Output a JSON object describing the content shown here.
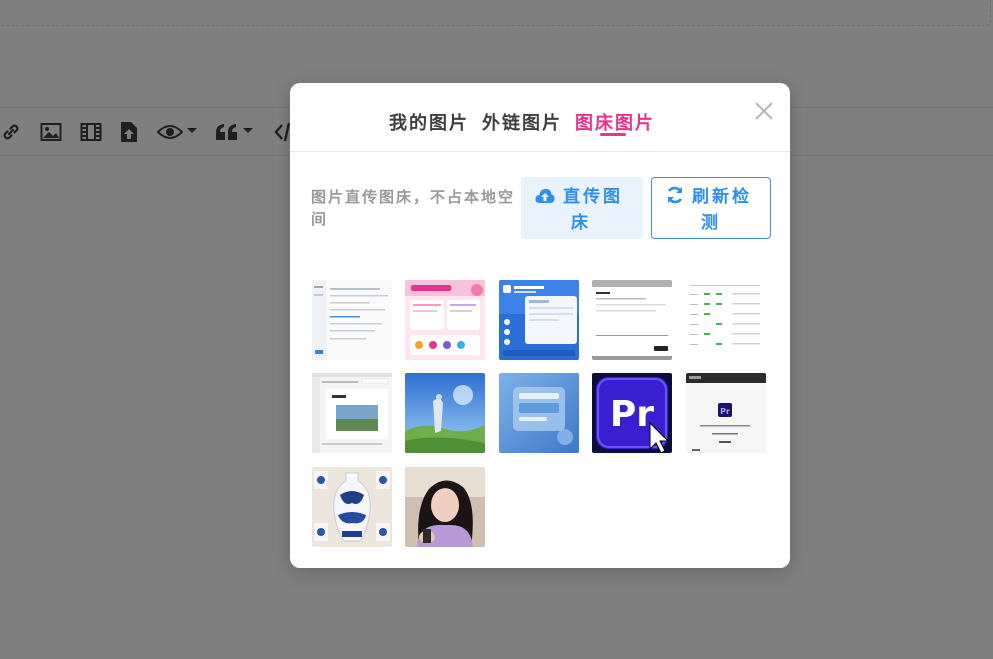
{
  "modal": {
    "tabs": [
      {
        "label": "我的图片",
        "active": false
      },
      {
        "label": "外链图片",
        "active": false
      },
      {
        "label": "图床图片",
        "active": true
      }
    ],
    "hint": "图片直传图床，不占本地空间",
    "upload_button": {
      "line1": "直传图",
      "line2": "床",
      "icon": "cloud-upload-icon"
    },
    "refresh_button": {
      "line1": "刷新检",
      "line2": "测",
      "icon": "refresh-icon"
    },
    "pr_logo_text": "Pr",
    "accent_color": "#e6338a",
    "button_color": "#2f8ff0"
  }
}
